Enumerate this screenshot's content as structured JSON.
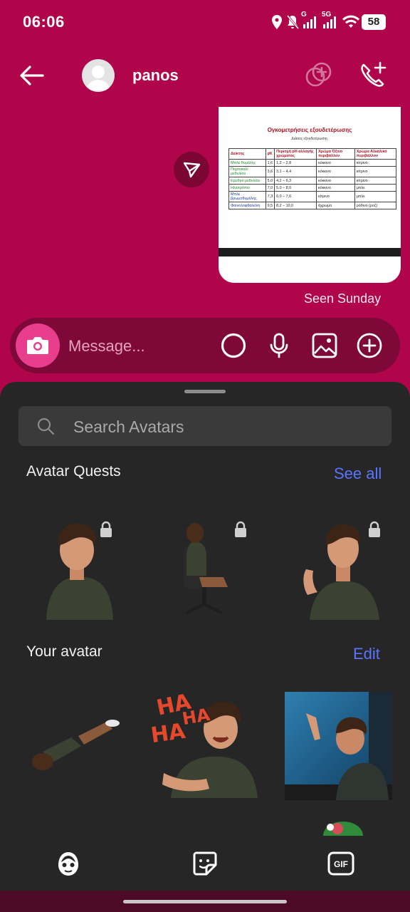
{
  "status_bar": {
    "time": "06:06",
    "battery": "58",
    "network_1": "G",
    "network_2": "5G"
  },
  "header": {
    "contact_name": "panos"
  },
  "thread": {
    "document": {
      "title": "Ογκομετρήσεις εξουδετέρωσης",
      "subtitle": "Δείκτες εξουδετέρωσης",
      "headers": [
        "Δείκτης",
        "pK",
        "Περιοχή pH αλλαγής χρώματος",
        "Χρώμα Όξινο περιβάλλον",
        "Χρώμα Αλκαλικό περιβάλλον"
      ],
      "rows": [
        [
          "Μπλε θυμόλης",
          "1,6",
          "1,2 – 2,8",
          "κόκκινο",
          "κίτρινο"
        ],
        [
          "Πορτοκαλί μεθυλίου",
          "3,6",
          "3,1 – 4,4",
          "κόκκινο",
          "κίτρινο"
        ],
        [
          "Ερυθρό μεθυλίου",
          "5,0",
          "4,2 – 6,3",
          "κόκκινο",
          "κίτρινο"
        ],
        [
          "Ηλιοτρόπιο",
          "7,0",
          "5,0 – 8,0",
          "κόκκινο",
          "μπλε"
        ],
        [
          "Μπλε βρωμοθυμόλης",
          "7,3",
          "6,0 – 7,6",
          "κίτρινο",
          "μπλε"
        ],
        [
          "Φαινολοφθαλεΐνη",
          "9,5",
          "8,2 – 10,0",
          "άχρωμο",
          "ρόδινο (ροζ)"
        ]
      ]
    },
    "seen_status": "Seen Sunday"
  },
  "composer": {
    "placeholder": "Message..."
  },
  "sheet": {
    "search_placeholder": "Search Avatars",
    "quests_title": "Avatar Quests",
    "quests_link": "See all",
    "your_avatar_title": "Your avatar",
    "your_avatar_link": "Edit",
    "haha_text": [
      "HA",
      "HA",
      "HA"
    ]
  },
  "colors": {
    "background": "#b0054a",
    "composer": "#7e0938",
    "camera": "#e93e8e",
    "sheet": "#262626",
    "link": "#5b74ff"
  },
  "nav_icons": [
    "avatar-icon",
    "sticker-icon",
    "gif-icon"
  ]
}
